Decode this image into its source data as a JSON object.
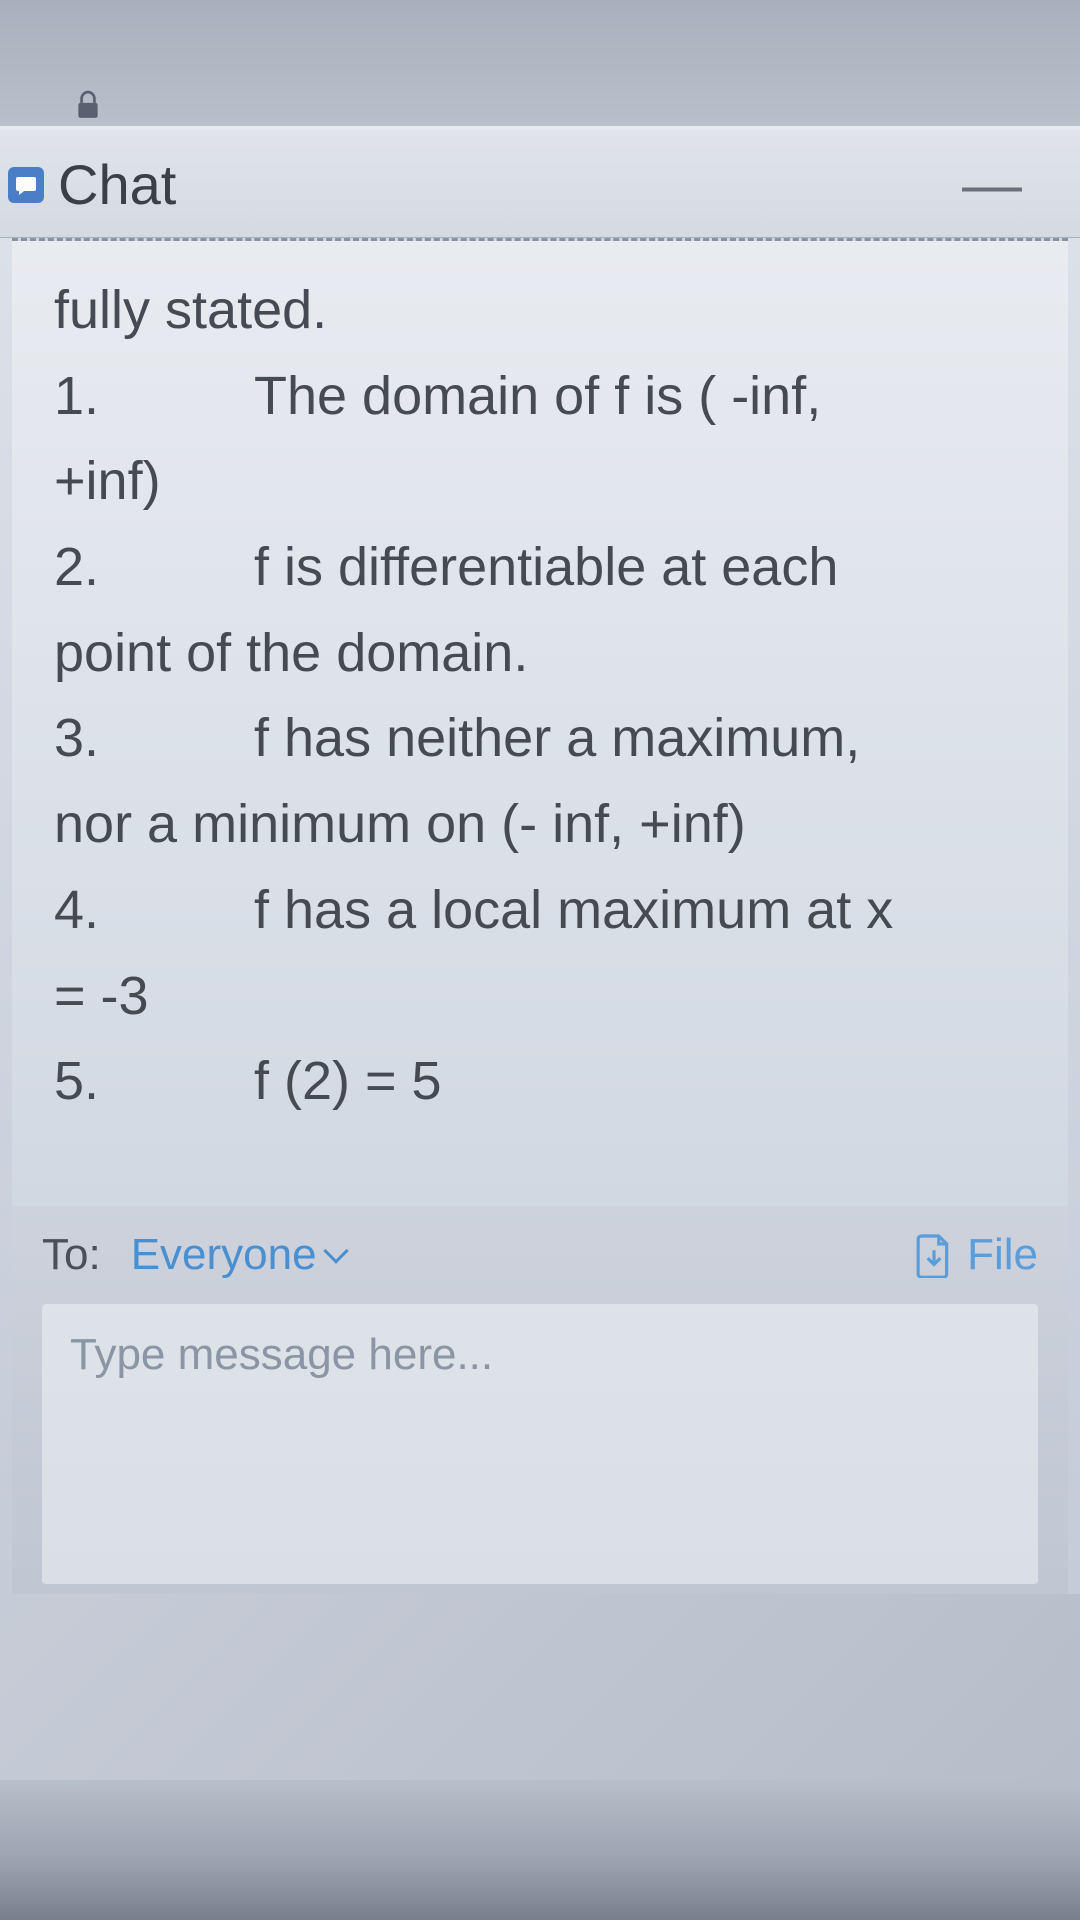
{
  "header": {
    "title": "Chat"
  },
  "message": {
    "line0": "fully stated.",
    "items": [
      {
        "num": "1.",
        "text_a": "The domain of f is ( -inf,",
        "text_b": "+inf)"
      },
      {
        "num": "2.",
        "text_a": "f is differentiable at each",
        "text_b": "point of the domain."
      },
      {
        "num": "3.",
        "text_a": "f has neither a maximum,",
        "text_b": "nor a minimum on (- inf, +inf)"
      },
      {
        "num": "4.",
        "text_a": "f has a local maximum at x",
        "text_b": "= -3"
      },
      {
        "num": "5.",
        "text_a": "f (2) = 5",
        "text_b": ""
      }
    ]
  },
  "compose": {
    "to_label": "To:",
    "recipient": "Everyone",
    "file_label": "File",
    "placeholder": "Type message here..."
  }
}
